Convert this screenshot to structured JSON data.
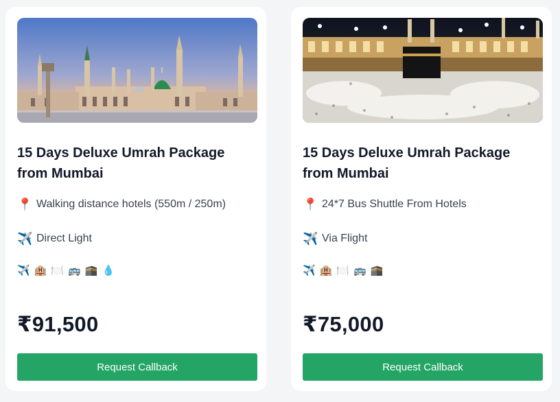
{
  "packages": [
    {
      "title": "15 Days Deluxe Umrah Package from Mumbai",
      "features": [
        {
          "icon": "pin-icon",
          "glyph": "📍",
          "text": "Walking distance hotels (550m / 250m)"
        },
        {
          "icon": "airplane-icon",
          "glyph": "✈️",
          "text": "Direct Light"
        }
      ],
      "amenities": [
        {
          "icon": "flight-icon",
          "glyph": "✈️"
        },
        {
          "icon": "hotel-icon",
          "glyph": "🏨"
        },
        {
          "icon": "meals-icon",
          "glyph": "🍽️"
        },
        {
          "icon": "bus-icon",
          "glyph": "🚌"
        },
        {
          "icon": "kaaba-icon",
          "glyph": "🕋"
        },
        {
          "icon": "zamzam-water-icon",
          "glyph": "💧"
        }
      ],
      "price": "₹91,500",
      "cta_label": "Request Callback"
    },
    {
      "title": "15 Days Deluxe Umrah Package from Mumbai",
      "features": [
        {
          "icon": "pin-icon",
          "glyph": "📍",
          "text": "24*7 Bus Shuttle From Hotels"
        },
        {
          "icon": "airplane-icon",
          "glyph": "✈️",
          "text": "Via Flight"
        }
      ],
      "amenities": [
        {
          "icon": "flight-icon",
          "glyph": "✈️"
        },
        {
          "icon": "hotel-icon",
          "glyph": "🏨"
        },
        {
          "icon": "meals-icon",
          "glyph": "🍽️"
        },
        {
          "icon": "bus-icon",
          "glyph": "🚌"
        },
        {
          "icon": "kaaba-icon",
          "glyph": "🕋"
        }
      ],
      "price": "₹75,000",
      "cta_label": "Request Callback"
    }
  ],
  "colors": {
    "page_bg": "#f4f5f7",
    "card_bg": "#ffffff",
    "cta_bg": "#24a566",
    "title_text": "#111827"
  }
}
